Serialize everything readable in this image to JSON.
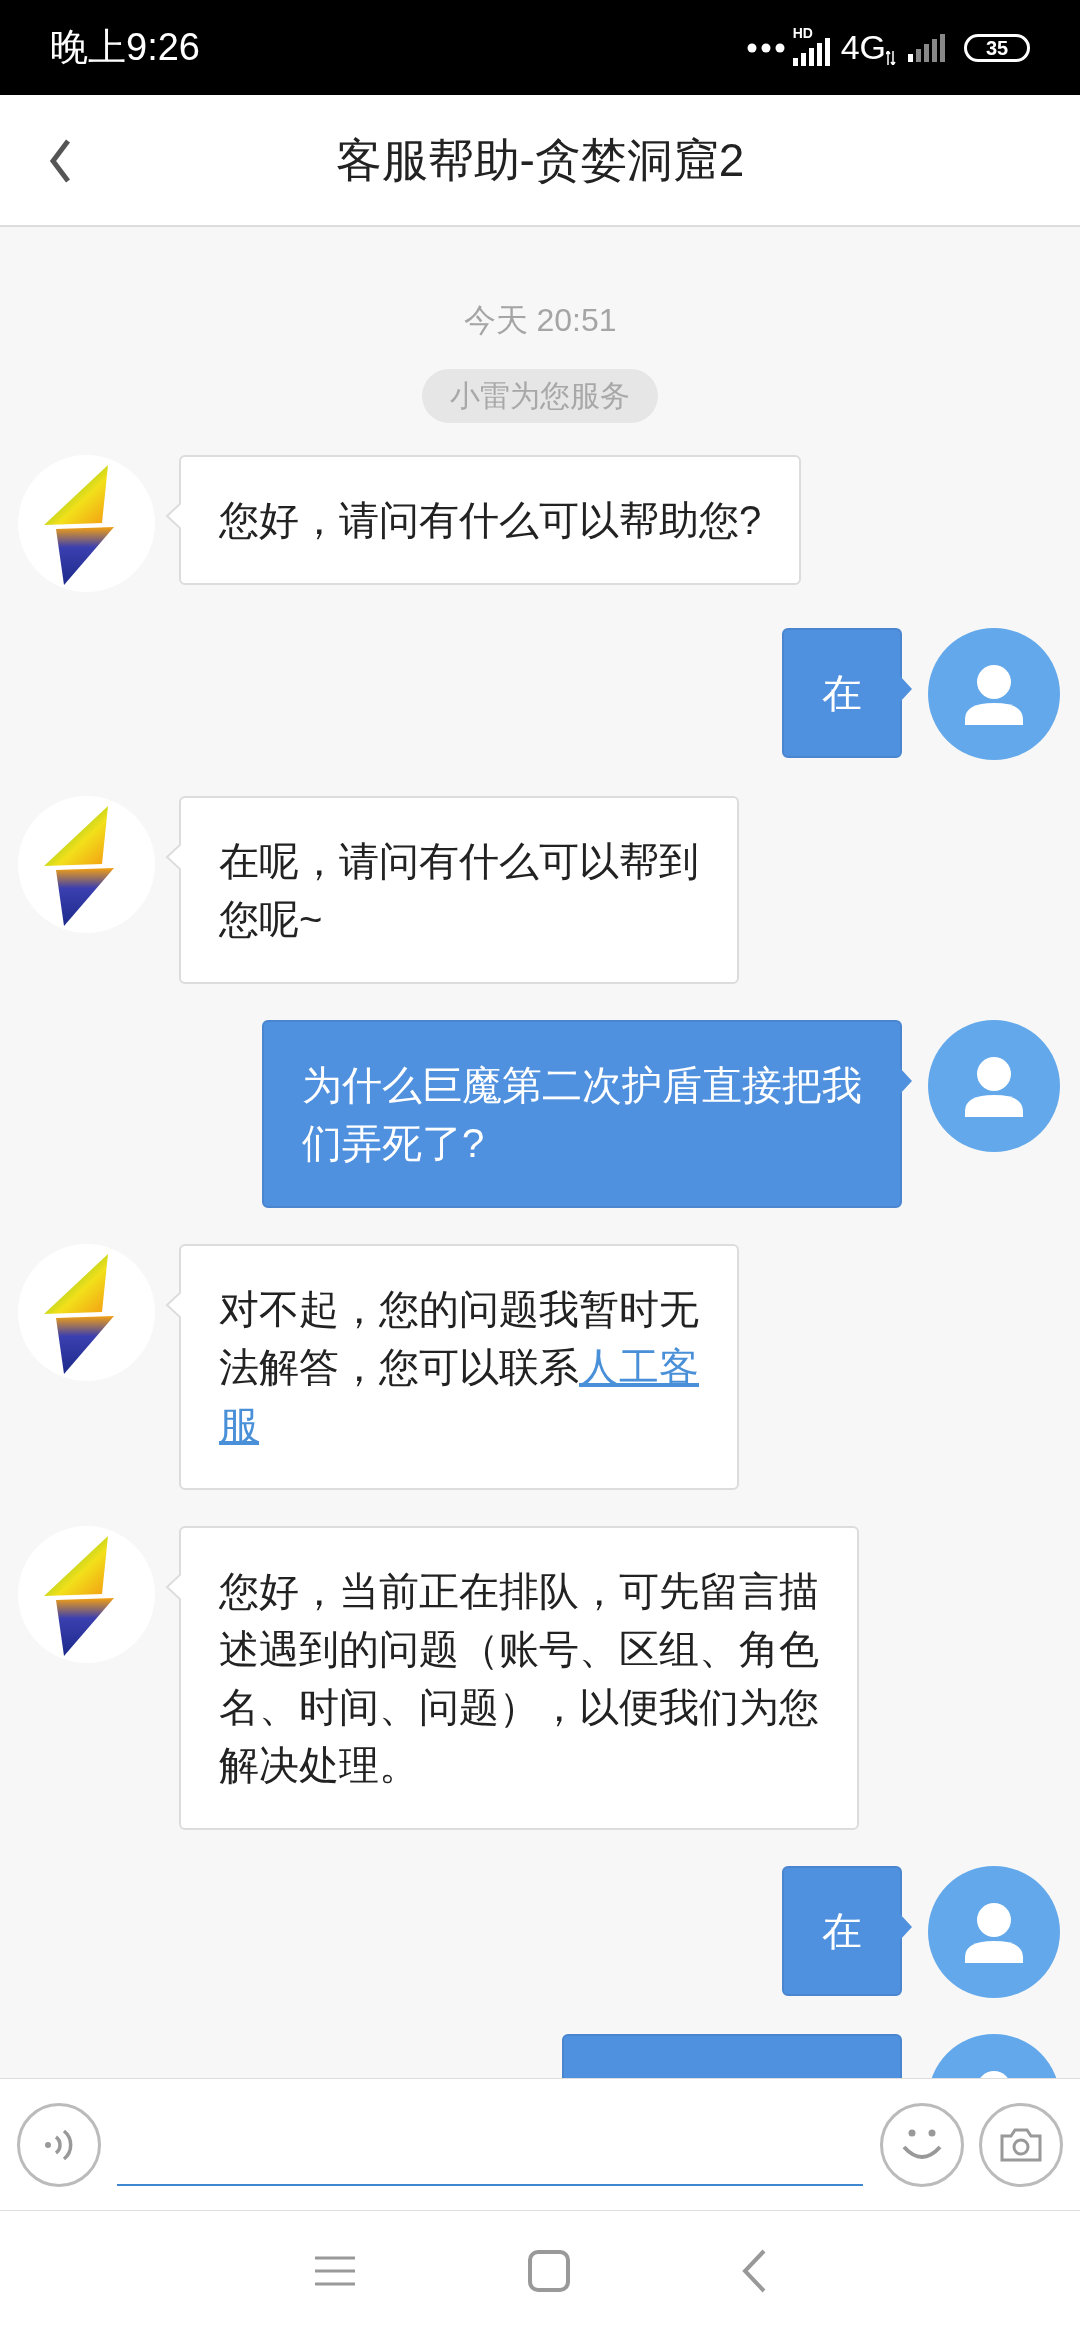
{
  "status_bar": {
    "time": "晚上9:26",
    "network_badge": "HD",
    "network": "4G",
    "battery": "35"
  },
  "header": {
    "title": "客服帮助-贪婪洞窟2"
  },
  "chat": {
    "timestamp": "今天 20:51",
    "notice": "小雷为您服务",
    "messages": [
      {
        "kind": "bot",
        "lines": [
          [
            {
              "kind": "text",
              "text": "您好，请问有什么可以帮助您?"
            }
          ]
        ]
      },
      {
        "kind": "user",
        "lines": [
          [
            {
              "kind": "text",
              "text": "在"
            }
          ]
        ]
      },
      {
        "kind": "bot",
        "lines": [
          [
            {
              "kind": "text",
              "text": "在呢，请问有什么可以帮到"
            }
          ],
          [
            {
              "kind": "text",
              "text": "您呢~"
            }
          ]
        ]
      },
      {
        "kind": "user",
        "lines": [
          [
            {
              "kind": "text",
              "text": "为什么巨魔第二次护盾直接把我"
            }
          ],
          [
            {
              "kind": "text",
              "text": "们弄死了?"
            }
          ]
        ]
      },
      {
        "kind": "bot",
        "lines": [
          [
            {
              "kind": "text",
              "text": "对不起，您的问题我暂时无"
            }
          ],
          [
            {
              "kind": "text",
              "text": "法解答，您可以联系"
            },
            {
              "kind": "link",
              "text": "人工客"
            }
          ],
          [
            {
              "kind": "link",
              "text": "服"
            }
          ]
        ]
      },
      {
        "kind": "bot",
        "lines": [
          [
            {
              "kind": "text",
              "text": "您好，当前正在排队，可先留言描"
            }
          ],
          [
            {
              "kind": "text",
              "text": "述遇到的问题（账号、区组、角色"
            }
          ],
          [
            {
              "kind": "text",
              "text": "名、时间、问题），以便我们为您"
            }
          ],
          [
            {
              "kind": "text",
              "text": "解决处理。"
            }
          ]
        ]
      },
      {
        "kind": "user",
        "lines": [
          [
            {
              "kind": "text",
              "text": "在"
            }
          ]
        ]
      },
      {
        "kind": "user"
      }
    ]
  }
}
